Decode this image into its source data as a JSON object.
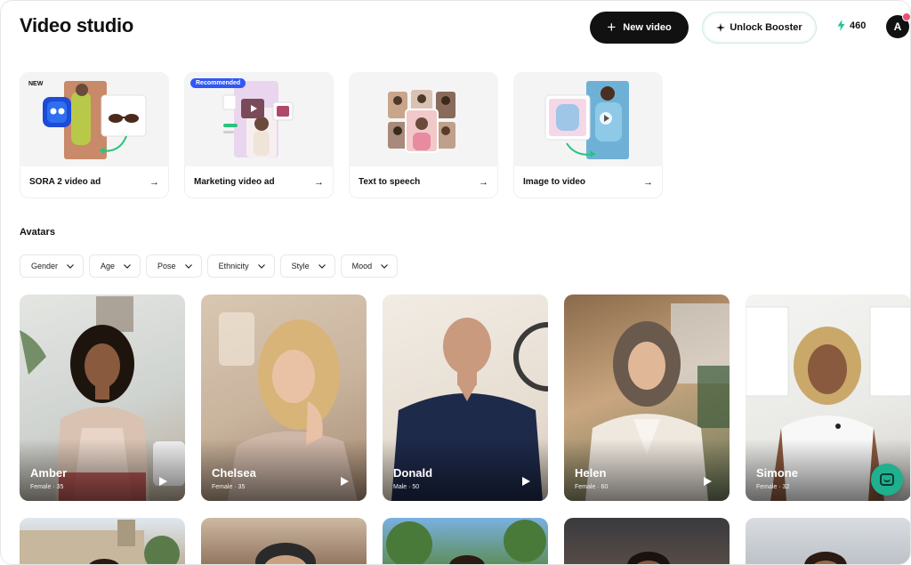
{
  "header": {
    "title": "Video studio",
    "new_video_label": "New video",
    "booster_label": "Unlock Booster",
    "credits": "460",
    "user_initial": "A"
  },
  "features": [
    {
      "label": "SORA 2 video ad",
      "badge": "NEW"
    },
    {
      "label": "Marketing video ad",
      "badge": "Recommended"
    },
    {
      "label": "Text to speech",
      "badge": ""
    },
    {
      "label": "Image to video",
      "badge": ""
    }
  ],
  "avatars_section": {
    "title": "Avatars",
    "filters": [
      "Gender",
      "Age",
      "Pose",
      "Ethnicity",
      "Style",
      "Mood"
    ]
  },
  "avatars": [
    {
      "name": "Amber",
      "meta": "Female · 35"
    },
    {
      "name": "Chelsea",
      "meta": "Female · 35"
    },
    {
      "name": "Donald",
      "meta": "Male · 50"
    },
    {
      "name": "Helen",
      "meta": "Female · 60"
    },
    {
      "name": "Simone",
      "meta": "Female · 32"
    }
  ],
  "colors": {
    "accent_dark": "#111111",
    "recommended_badge": "#3158f5",
    "credits_bolt": "#22c29a",
    "chat_button": "#1fb08f"
  }
}
